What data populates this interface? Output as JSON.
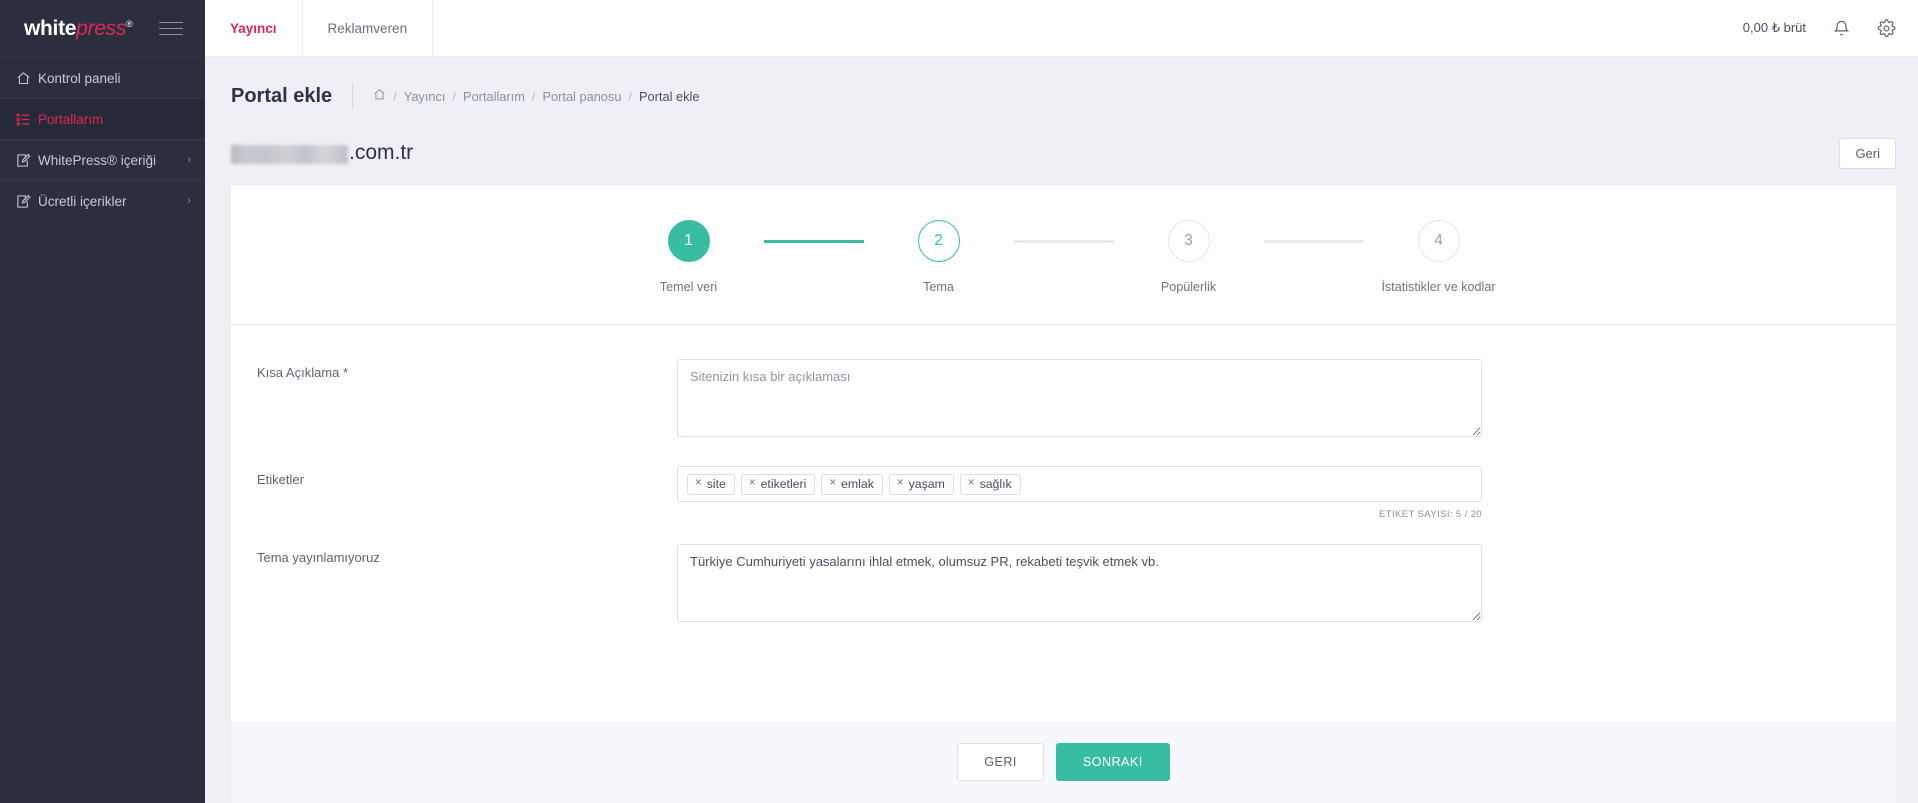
{
  "brand": {
    "part1": "white",
    "part2": "press",
    "registered": "®"
  },
  "sidebar": {
    "items": [
      {
        "label": "Kontrol paneli",
        "icon": "home-icon",
        "active": false,
        "chevron": ""
      },
      {
        "label": "Portallarım",
        "icon": "list-icon",
        "active": true,
        "chevron": ""
      },
      {
        "label": "WhitePress® içeriği",
        "icon": "edit-icon",
        "active": false,
        "chevron": "›"
      },
      {
        "label": "Ücretli içerikler",
        "icon": "edit-icon",
        "active": false,
        "chevron": "›"
      }
    ]
  },
  "topbar": {
    "tabs": [
      {
        "label": "Yayıncı",
        "active": true
      },
      {
        "label": "Reklamveren",
        "active": false
      }
    ],
    "balance": "0,00 ₺ brüt",
    "bell_icon": "bell-icon",
    "gear_icon": "gear-icon"
  },
  "page": {
    "title": "Portal ekle",
    "breadcrumb": {
      "home_icon": "home-icon",
      "items": [
        "Yayıncı",
        "Portallarım",
        "Portal panosu",
        "Portal ekle"
      ],
      "separator": "/"
    },
    "site_name_suffix": ".com.tr",
    "site_name_redacted": true,
    "back_button": "Geri"
  },
  "stepper": {
    "steps": [
      {
        "number": "1",
        "label": "Temel veri",
        "state": "done"
      },
      {
        "number": "2",
        "label": "Tema",
        "state": "active"
      },
      {
        "number": "3",
        "label": "Popülerlik",
        "state": "idle"
      },
      {
        "number": "4",
        "label": "İstatistikler ve kodlar",
        "state": "idle"
      }
    ]
  },
  "form": {
    "short_description": {
      "label": "Kısa Açıklama *",
      "placeholder": "Sitenizin kısa bir açıklaması",
      "value": ""
    },
    "tags": {
      "label": "Etiketler",
      "items": [
        "site",
        "etiketleri",
        "emlak",
        "yaşam",
        "sağlık"
      ],
      "remove_glyph": "×",
      "counter": "ETIKET SAYISI: 5 / 20"
    },
    "not_publishing": {
      "label": "Tema yayınlamıyoruz",
      "value": "Türkiye Cumhuriyeti yasalarını ihlal etmek, olumsuz PR, rekabeti teşvik etmek vb.",
      "placeholder": ""
    }
  },
  "footer": {
    "back": "GERI",
    "next": "SONRAKI"
  },
  "colors": {
    "accent_teal": "#38bda3",
    "brand_red": "#e0274f",
    "sidebar_bg": "#2b2e3f",
    "page_bg": "#eef0f5"
  }
}
